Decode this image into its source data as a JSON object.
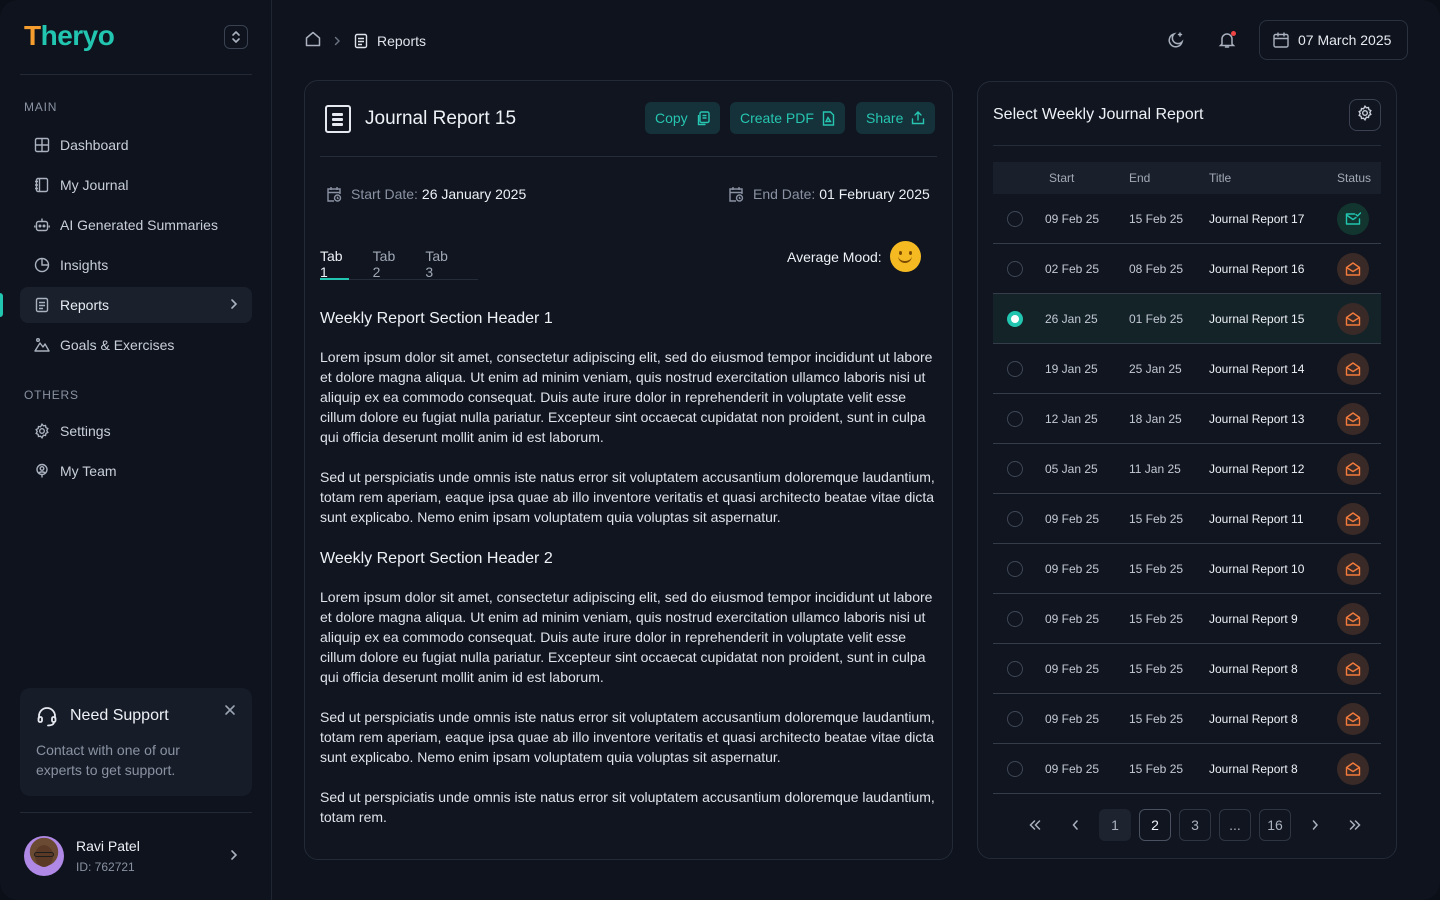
{
  "brand": {
    "logo_first": "T",
    "logo_rest": "heryo"
  },
  "sidebar": {
    "main_label": "MAIN",
    "others_label": "OTHERS",
    "items": [
      {
        "label": "Dashboard",
        "icon": "grid-icon"
      },
      {
        "label": "My Journal",
        "icon": "notebook-icon"
      },
      {
        "label": "AI Generated Summaries",
        "icon": "robot-icon"
      },
      {
        "label": "Insights",
        "icon": "pie-chart-icon"
      },
      {
        "label": "Reports",
        "icon": "report-icon",
        "active": true
      },
      {
        "label": "Goals & Exercises",
        "icon": "mountain-icon"
      }
    ],
    "others": [
      {
        "label": "Settings",
        "icon": "gear-icon"
      },
      {
        "label": "My Team",
        "icon": "team-icon"
      }
    ],
    "support": {
      "title": "Need Support",
      "description": "Contact with one of our experts to get support."
    },
    "user": {
      "name": "Ravi Patel",
      "id": "ID: 762721"
    }
  },
  "header": {
    "breadcrumb_current": "Reports",
    "date": "07 March 2025"
  },
  "report": {
    "title": "Journal Report 15",
    "actions": {
      "copy": "Copy",
      "pdf": "Create PDF",
      "share": "Share"
    },
    "start_label": "Start Date:",
    "start_value": "26 January 2025",
    "end_label": "End Date:",
    "end_value": "01 February 2025",
    "tabs": [
      "Tab 1",
      "Tab 2",
      "Tab 3"
    ],
    "mood_label": "Average Mood:",
    "sections": [
      {
        "header": "Weekly Report Section Header 1",
        "paragraphs": [
          "Lorem ipsum dolor sit amet, consectetur adipiscing elit, sed do eiusmod tempor incididunt ut labore et dolore magna aliqua. Ut enim ad minim veniam, quis nostrud exercitation ullamco laboris nisi ut aliquip ex ea commodo consequat. Duis aute irure dolor in reprehenderit in voluptate velit esse cillum dolore eu fugiat nulla pariatur. Excepteur sint occaecat cupidatat non proident, sunt in culpa qui officia deserunt mollit anim id est laborum.",
          "Sed ut perspiciatis unde omnis iste natus error sit voluptatem accusantium doloremque laudantium, totam rem aperiam, eaque ipsa quae ab illo inventore veritatis et quasi architecto beatae vitae dicta sunt explicabo. Nemo enim ipsam voluptatem quia voluptas sit aspernatur."
        ]
      },
      {
        "header": "Weekly Report Section Header 2",
        "paragraphs": [
          "Lorem ipsum dolor sit amet, consectetur adipiscing elit, sed do eiusmod tempor incididunt ut labore et dolore magna aliqua. Ut enim ad minim veniam, quis nostrud exercitation ullamco laboris nisi ut aliquip ex ea commodo consequat. Duis aute irure dolor in reprehenderit in voluptate velit esse cillum dolore eu fugiat nulla pariatur. Excepteur sint occaecat cupidatat non proident, sunt in culpa qui officia deserunt mollit anim id est laborum.",
          "Sed ut perspiciatis unde omnis iste natus error sit voluptatem accusantium doloremque laudantium, totam rem aperiam, eaque ipsa quae ab illo inventore veritatis et quasi architecto beatae vitae dicta sunt explicabo. Nemo enim ipsam voluptatem quia voluptas sit aspernatur.",
          "Sed ut perspiciatis unde omnis iste natus error sit voluptatem accusantium doloremque laudantium, totam rem."
        ]
      }
    ]
  },
  "list": {
    "title": "Select Weekly Journal Report",
    "columns": {
      "start": "Start",
      "end": "End",
      "title": "Title",
      "status": "Status"
    },
    "rows": [
      {
        "start": "09 Feb 25",
        "end": "15 Feb 25",
        "title": "Journal Report 17",
        "status": "done"
      },
      {
        "start": "02 Feb 25",
        "end": "08 Feb 25",
        "title": "Journal Report 16",
        "status": "pending"
      },
      {
        "start": "26 Jan 25",
        "end": "01 Feb 25",
        "title": "Journal Report 15",
        "status": "pending",
        "selected": true
      },
      {
        "start": "19 Jan 25",
        "end": "25 Jan 25",
        "title": "Journal Report 14",
        "status": "pending"
      },
      {
        "start": "12 Jan 25",
        "end": "18 Jan 25",
        "title": "Journal Report 13",
        "status": "pending"
      },
      {
        "start": "05 Jan 25",
        "end": "11 Jan 25",
        "title": "Journal Report 12",
        "status": "pending"
      },
      {
        "start": "09 Feb 25",
        "end": "15 Feb 25",
        "title": "Journal Report 11",
        "status": "pending"
      },
      {
        "start": "09 Feb 25",
        "end": "15 Feb 25",
        "title": "Journal Report 10",
        "status": "pending"
      },
      {
        "start": "09 Feb 25",
        "end": "15 Feb 25",
        "title": "Journal Report 9",
        "status": "pending"
      },
      {
        "start": "09 Feb 25",
        "end": "15 Feb 25",
        "title": "Journal Report 8",
        "status": "pending"
      },
      {
        "start": "09 Feb 25",
        "end": "15 Feb 25",
        "title": "Journal Report 8",
        "status": "pending"
      },
      {
        "start": "09 Feb 25",
        "end": "15 Feb 25",
        "title": "Journal Report 8",
        "status": "pending"
      }
    ],
    "pagination": {
      "pages": [
        "1",
        "2",
        "3",
        "...",
        "16"
      ],
      "current": "2"
    }
  },
  "colors": {
    "accent": "#22c5b0",
    "brand_orange": "#f59e2f",
    "pending": "#f27a3c",
    "background": "#0e131d"
  }
}
